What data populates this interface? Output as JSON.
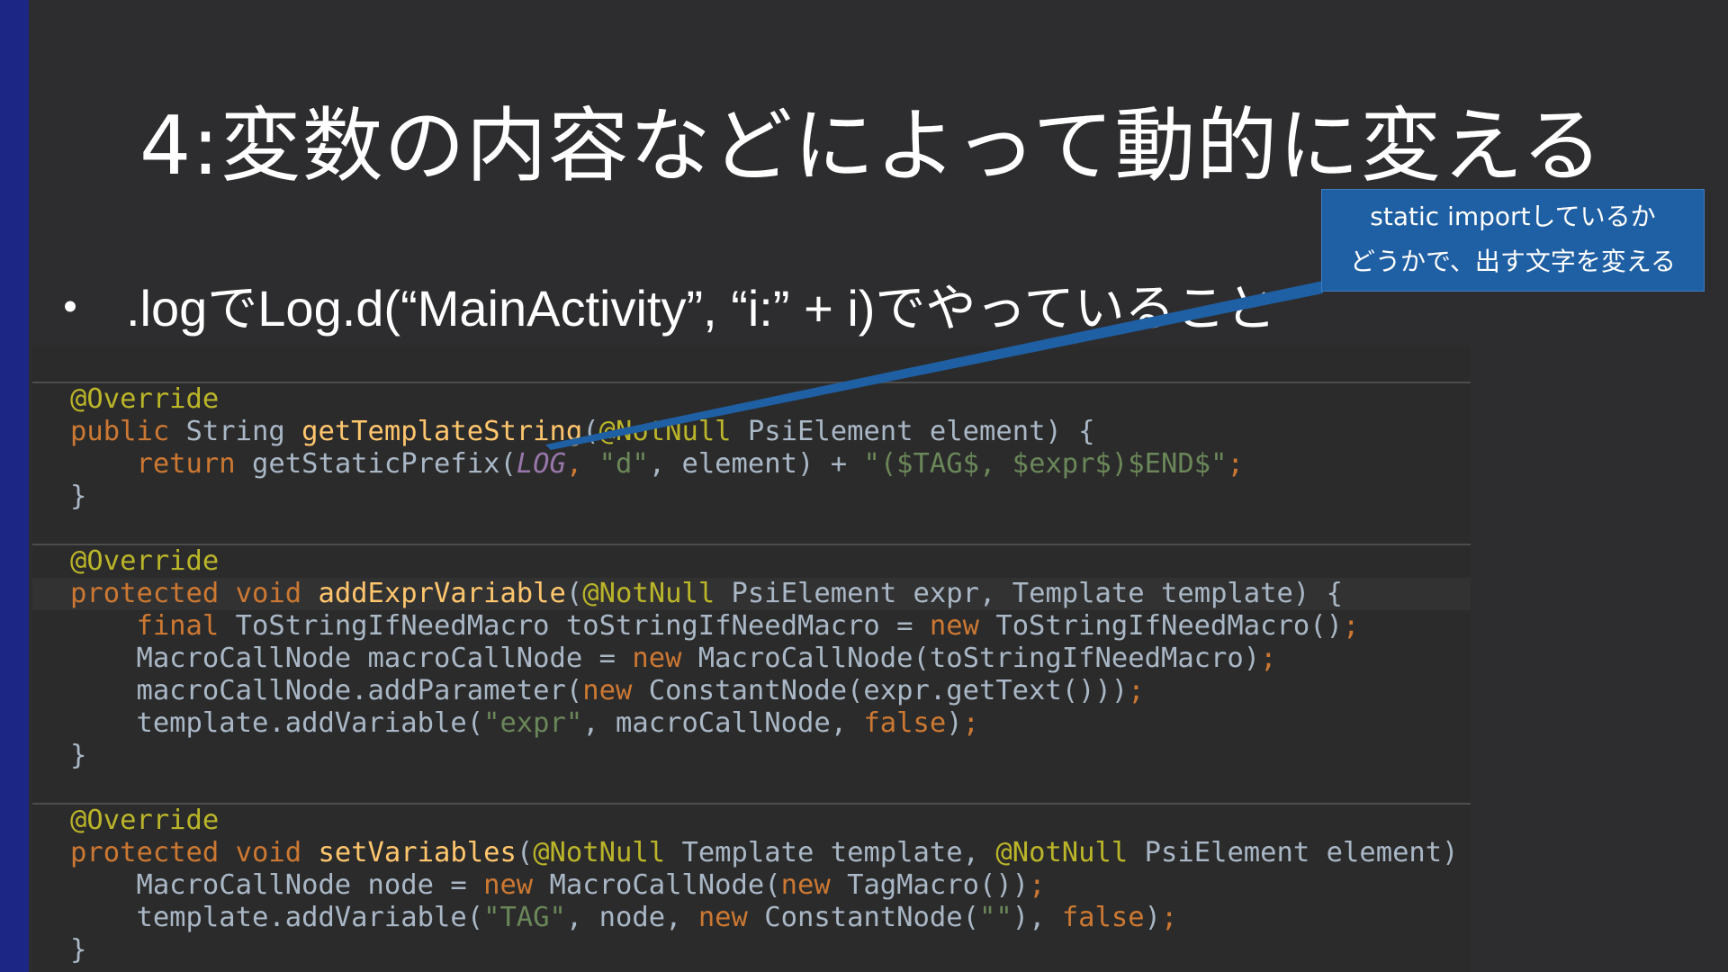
{
  "slide": {
    "title": "4:変数の内容などによって動的に変える",
    "bullet_marker": "・",
    "bullet_text": ".logでLog.d(“MainActivity”, “i:” + i)でやっていること"
  },
  "callout": {
    "line1": "static importしているか",
    "line2": "どうかで、出す文字を変える"
  },
  "code": {
    "m1": {
      "annotation": "@Override",
      "sig_public": "public",
      "sig_string": " String ",
      "sig_method": "getTemplateString",
      "sig_paren": "(",
      "sig_notnull": "@NotNull",
      "sig_rest": " PsiElement element) {",
      "body_return": "return",
      "body_call": " getStaticPrefix(",
      "body_log": "LOG",
      "body_comma1": ", ",
      "body_d": "\"d\"",
      "body_comma2": ", element) + ",
      "body_tpl": "\"($TAG$, $expr$)$END$\"",
      "body_semi": ";",
      "close": "}"
    },
    "m2": {
      "annotation": "@Override",
      "sig_protected": "protected",
      "sig_void": " void ",
      "sig_method": "addExprVariable",
      "sig_paren": "(",
      "sig_notnull": "@NotNull",
      "sig_rest": " PsiElement expr, Template template) {",
      "l1_final": "final",
      "l1_a": " ToStringIfNeedMacro toStringIfNeedMacro = ",
      "l1_new": "new",
      "l1_b": " ToStringIfNeedMacro()",
      "l1_semi": ";",
      "l2_a": "MacroCallNode macroCallNode = ",
      "l2_new": "new",
      "l2_b": " MacroCallNode(toStringIfNeedMacro)",
      "l2_semi": ";",
      "l3_a": "macroCallNode.addParameter(",
      "l3_new": "new",
      "l3_b": " ConstantNode(expr.getText()))",
      "l3_semi": ";",
      "l4_a": "template.addVariable(",
      "l4_str": "\"expr\"",
      "l4_b": ", macroCallNode, ",
      "l4_false": "false",
      "l4_c": ")",
      "l4_semi": ";",
      "close": "}"
    },
    "m3": {
      "annotation": "@Override",
      "sig_protected": "protected",
      "sig_void": " void ",
      "sig_method": "setVariables",
      "sig_paren": "(",
      "sig_notnull1": "@NotNull",
      "sig_mid": " Template template, ",
      "sig_notnull2": "@NotNull",
      "sig_rest": " PsiElement element) {",
      "l1_a": "MacroCallNode node = ",
      "l1_new1": "new",
      "l1_b": " MacroCallNode(",
      "l1_new2": "new",
      "l1_c": " TagMacro())",
      "l1_semi": ";",
      "l2_a": "template.addVariable(",
      "l2_tag": "\"TAG\"",
      "l2_b": ", node, ",
      "l2_new": "new",
      "l2_c": " ConstantNode(",
      "l2_empty": "\"\"",
      "l2_d": "), ",
      "l2_false": "false",
      "l2_e": ")",
      "l2_semi": ";",
      "close": "}"
    }
  },
  "colors": {
    "background": "#2d2d2f",
    "accent_bar": "#1c2684",
    "callout": "#1f5fa3",
    "annotation": "#bbb529",
    "keyword": "#cc7832",
    "string": "#6a8759",
    "method": "#ffc66d"
  }
}
